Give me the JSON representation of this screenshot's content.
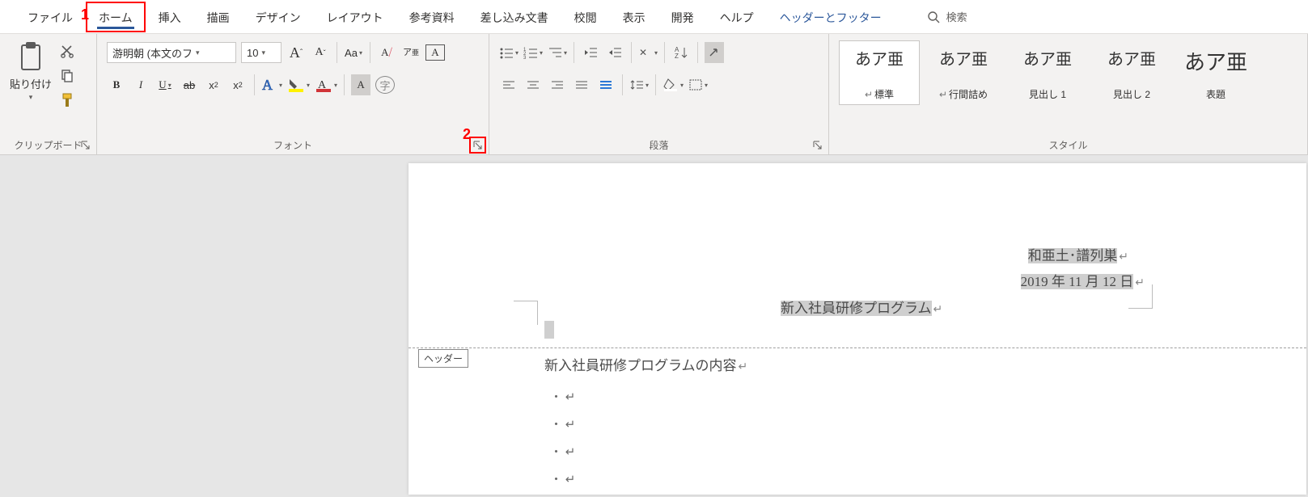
{
  "callouts": {
    "one": "1",
    "two": "2"
  },
  "tabs": {
    "file": "ファイル",
    "home": "ホーム",
    "insert": "挿入",
    "draw": "描画",
    "design": "デザイン",
    "layout": "レイアウト",
    "references": "参考資料",
    "mailings": "差し込み文書",
    "review": "校閲",
    "view": "表示",
    "developer": "開発",
    "help": "ヘルプ",
    "context": "ヘッダーとフッター",
    "search": "検索"
  },
  "clipboard": {
    "label": "クリップボード",
    "paste": "貼り付け"
  },
  "font": {
    "label": "フォント",
    "name": "游明朝 (本文のフ",
    "size": "10",
    "bold": "B",
    "italic": "I",
    "underline": "U",
    "strike": "ab",
    "sub": "x₂",
    "sup": "x²",
    "case": "Aa",
    "ruby": "ア",
    "enclosed": "字"
  },
  "paragraph": {
    "label": "段落"
  },
  "styles": {
    "label": "スタイル",
    "preview": "あア亜",
    "items": [
      {
        "name": "標準",
        "ret": true
      },
      {
        "name": "行間詰め",
        "ret": true
      },
      {
        "name": "見出し 1",
        "ret": false
      },
      {
        "name": "見出し 2",
        "ret": false
      },
      {
        "name": "表題",
        "ret": false,
        "big": true
      }
    ]
  },
  "document": {
    "header_label": "ヘッダー",
    "line1": "和亜土･譜列巣",
    "line2": "2019 年 11 月 12 日",
    "title": "新入社員研修プログラム",
    "body1": "新入社員研修プログラムの内容"
  }
}
